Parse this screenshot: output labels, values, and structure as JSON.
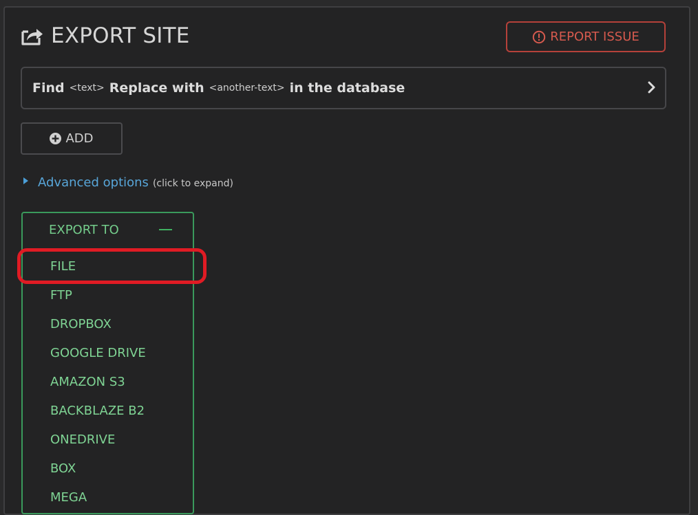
{
  "header": {
    "title": "EXPORT SITE",
    "title_icon": "export-share-icon",
    "report_label": "REPORT ISSUE",
    "report_icon": "alert-circle-icon"
  },
  "find_replace": {
    "find_label": "Find",
    "find_placeholder": "<text>",
    "replace_label": "Replace with",
    "replace_placeholder": "<another-text>",
    "suffix": "in the database"
  },
  "add_button": {
    "label": "ADD",
    "icon": "plus-circle-icon"
  },
  "advanced": {
    "label": "Advanced options",
    "hint": "(click to expand)"
  },
  "export_to": {
    "heading": "EXPORT TO",
    "items": [
      "FILE",
      "FTP",
      "DROPBOX",
      "GOOGLE DRIVE",
      "AMAZON S3",
      "BACKBLAZE B2",
      "ONEDRIVE",
      "BOX",
      "MEGA"
    ]
  },
  "colors": {
    "background": "#232324",
    "accent_green": "#7fd494",
    "report_red": "#d65a4e",
    "link_blue": "#58a6d9",
    "highlight_red": "#e01b24"
  }
}
